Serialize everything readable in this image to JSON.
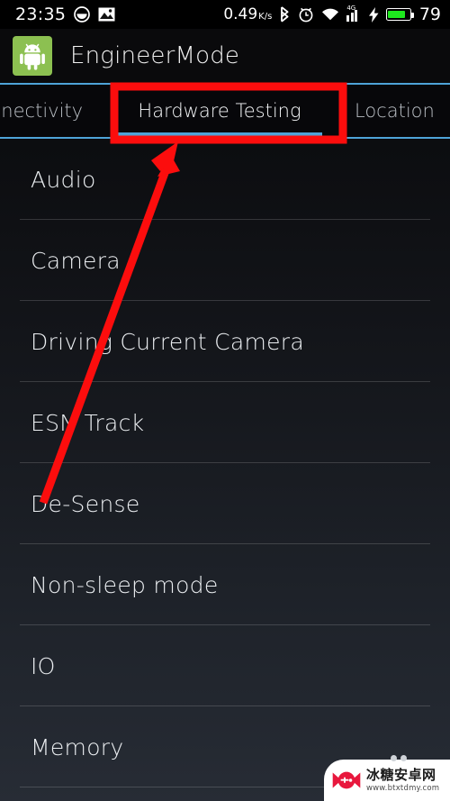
{
  "status_bar": {
    "clock": "23:35",
    "left_icons": [
      "smiley-icon",
      "image-icon"
    ],
    "network_speed": "0.49",
    "network_speed_unit": "K/s",
    "right_icons": [
      "bluetooth-icon",
      "alarm-clock-icon",
      "wifi-icon",
      "signal-bars-icon",
      "charging-bolt-icon",
      "battery-icon"
    ],
    "network_type": "4G",
    "battery_percent": "79",
    "battery_color": "#1ee81e"
  },
  "titlebar": {
    "app_name": "EngineerMode",
    "icon": "android-robot-icon",
    "icon_bg": "#8cc051"
  },
  "tabs": {
    "accent_color": "#4ea3d8",
    "items": [
      {
        "label": "nnectivity",
        "active": false
      },
      {
        "label": "Hardware Testing",
        "active": true
      },
      {
        "label": "Location",
        "active": false
      }
    ]
  },
  "list": {
    "items": [
      {
        "label": "Audio"
      },
      {
        "label": "Camera"
      },
      {
        "label": "Driving Current Camera"
      },
      {
        "label": "ESN Track"
      },
      {
        "label": "De-Sense"
      },
      {
        "label": "Non-sleep mode"
      },
      {
        "label": "IO"
      },
      {
        "label": "Memory"
      }
    ]
  },
  "annotation": {
    "color": "#fc0d0d",
    "highlight_box": "red-rectangle-around-hardware-testing-tab",
    "arrow": "red-arrow-pointing-to-hardware-testing-tab"
  },
  "watermark": {
    "site_name": "冰糖安卓网",
    "url": "www.btxtdmy.com",
    "logo": "candy-gamepad-logo-icon",
    "logo_color": "#e8173d"
  }
}
